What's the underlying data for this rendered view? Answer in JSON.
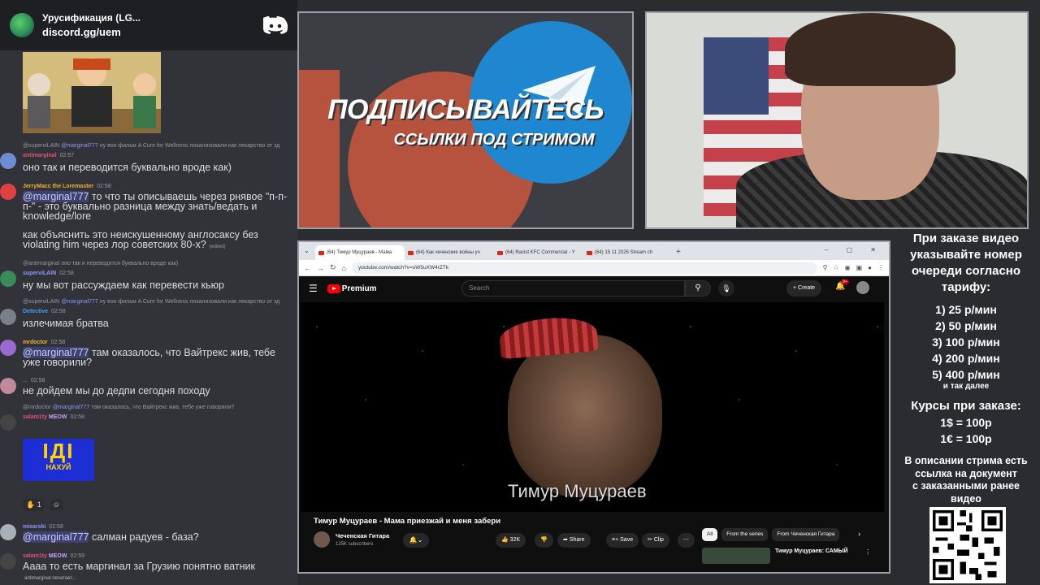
{
  "discord": {
    "server_name": "Урусификация (LG...",
    "invite": "discord.gg/uem",
    "messages": [
      {
        "reply_author": "@superviLAIN",
        "reply_mention": "@marginal777",
        "reply_text": "ну вон фильм A Cure for Wellness локализовали как лекарство от зд",
        "author": "antimarginal",
        "time": "02:57",
        "text": "оно так и переводится буквально вроде как)"
      },
      {
        "author": "JerryMacc the Loremaster",
        "time": "02:58",
        "mention": "@marginal777",
        "text": " то что ты описываешь через рнявое \"п-п-п-\" - это буквально разница между знать/ведать и knowledge/lore"
      },
      {
        "text": "как объяснить это неискушенному англосаксу без violating him через лор советских 80-х?",
        "edited": "(edited)"
      },
      {
        "reply_author": "@antimarginal",
        "reply_text": "оно так и переводится буквально вроде как)",
        "author": "superviLAIN",
        "time": "02:58",
        "text": "ну мы вот рассуждаем как перевести кьюр"
      },
      {
        "reply_author": "@superviLAIN",
        "reply_mention": "@marginal777",
        "reply_text": "ну вон фильм A Cure for Wellness локализовали как лекарство от зд",
        "author": "Detective",
        "time": "02:58",
        "text": "излечимая братва"
      },
      {
        "author": "mrdoctor",
        "time": "02:58",
        "mention": "@marginal777",
        "text": " там оказалось, что Вайтрекс жив, тебе уже говорили?"
      },
      {
        "author": "...",
        "time": "02:58",
        "text": "не дойдем мы до дедпи сегодня походу"
      },
      {
        "reply_author": "@mrdoctor",
        "reply_mention": "@marginal777",
        "reply_text": "там оказалось, что Вайтрекс жив, тебе уже говорили?",
        "author": "salam1ty",
        "badge": "MEOW",
        "time": "02:58"
      },
      {
        "author": "misarski",
        "time": "02:58",
        "mention": "@marginal777",
        "text": " салман радуев - база?"
      },
      {
        "author": "salam1ty",
        "badge": "MEOW",
        "time": "02:59",
        "text": "Аааа то есть маргинал за Грузию понятно ватник"
      }
    ],
    "gif_text_big": "ІДІ",
    "gif_text_small": "НАХУЙ",
    "reaction_count": "1",
    "typing": "antimarginal печатает..."
  },
  "promo": {
    "title": "ПОДПИСЫВАЙТЕСЬ",
    "subtitle": "ССЫЛКИ ПОД СТРИМОМ"
  },
  "browser": {
    "tabs": [
      "(64) Тимур Муцураев - Мама",
      "(64) Как чеченские войны уч",
      "(64) Racist KFC Commercial - Y",
      "(64) 15 11 2025 Stream ch"
    ],
    "new_tab": "+",
    "url": "youtube.com/watch?v=uW5uXW4rZTk",
    "window_controls": "– ▢ ✕"
  },
  "youtube": {
    "logo": "Premium",
    "search_placeholder": "Search",
    "create": "Create",
    "notif_badge": "9+",
    "video_caption": "Тимур Муцураев",
    "title": "Тимур Муцураев - Мама приезжай и меня забери",
    "channel": "Чеченская Гитара",
    "subs": "125K subscribers",
    "likes": "32K",
    "share": "Share",
    "save": "Save",
    "clip": "Clip",
    "chips": [
      "All",
      "From the series",
      "From Чеченская Гитара"
    ],
    "rec_title": "Тимур Муцураев: САМЫЙ"
  },
  "pricing": {
    "header": [
      "При заказе видео",
      "указывайте номер",
      "очереди согласно",
      "тарифу:"
    ],
    "tiers": [
      "1) 25 р/мин",
      "2) 50 р/мин",
      "3) 100 р/мин",
      "4) 200 р/мин",
      "5) 400 р/мин"
    ],
    "etc": "и так далее",
    "rates_title": "Курсы при заказе:",
    "rates": [
      "1$ = 100р",
      "1€ = 100р"
    ],
    "note": [
      "В описании стрима есть",
      "ссылка на документ",
      "с заказанными ранее",
      "видео"
    ]
  },
  "colors": {
    "discord_bg": "#313338",
    "mention": "#c9cdfb",
    "patreon": "#b5533e",
    "telegram": "#1e87d0",
    "youtube_red": "#ff0000"
  }
}
